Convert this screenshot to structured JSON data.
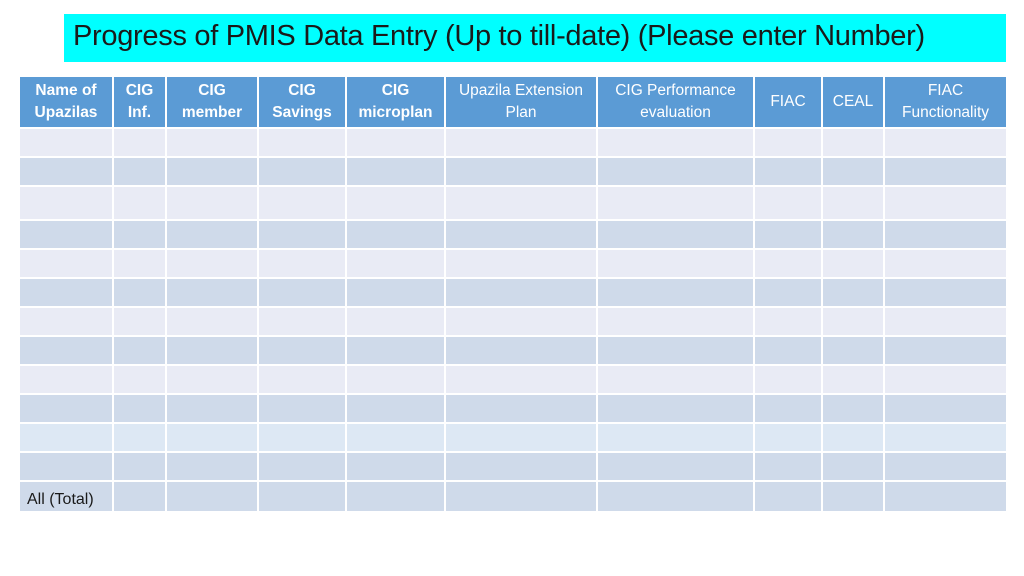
{
  "title": "Progress of PMIS Data Entry (Up to till-date) (Please enter Number)",
  "colors": {
    "title_background": "#00FFFF",
    "header_background": "#5B9BD5",
    "row_light": "#E9EBF5",
    "row_dark": "#CFDAEA"
  },
  "table": {
    "columns": [
      {
        "line1": "Name of",
        "line2": "Upazilas"
      },
      {
        "line1": "CIG",
        "line2": "Inf."
      },
      {
        "line1": "CIG",
        "line2": "member"
      },
      {
        "line1": "CIG",
        "line2": "Savings"
      },
      {
        "line1": "CIG",
        "line2": "microplan"
      },
      {
        "line1": "Upazila Extension",
        "line2": "Plan"
      },
      {
        "line1": "CIG Performance",
        "line2": "evaluation"
      },
      {
        "line1": "FIAC",
        "line2": ""
      },
      {
        "line1": "CEAL",
        "line2": ""
      },
      {
        "line1": "FIAC",
        "line2": "Functionality"
      }
    ],
    "rows": [
      [
        "",
        "",
        "",
        "",
        "",
        "",
        "",
        "",
        "",
        ""
      ],
      [
        "",
        "",
        "",
        "",
        "",
        "",
        "",
        "",
        "",
        ""
      ],
      [
        "",
        "",
        "",
        "",
        "",
        "",
        "",
        "",
        "",
        ""
      ],
      [
        "",
        "",
        "",
        "",
        "",
        "",
        "",
        "",
        "",
        ""
      ],
      [
        "",
        "",
        "",
        "",
        "",
        "",
        "",
        "",
        "",
        ""
      ],
      [
        "",
        "",
        "",
        "",
        "",
        "",
        "",
        "",
        "",
        ""
      ],
      [
        "",
        "",
        "",
        "",
        "",
        "",
        "",
        "",
        "",
        ""
      ],
      [
        "",
        "",
        "",
        "",
        "",
        "",
        "",
        "",
        "",
        ""
      ],
      [
        "",
        "",
        "",
        "",
        "",
        "",
        "",
        "",
        "",
        ""
      ],
      [
        "",
        "",
        "",
        "",
        "",
        "",
        "",
        "",
        "",
        ""
      ],
      [
        "",
        "",
        "",
        "",
        "",
        "",
        "",
        "",
        "",
        ""
      ],
      [
        "",
        "",
        "",
        "",
        "",
        "",
        "",
        "",
        "",
        ""
      ]
    ],
    "total_row_label": "All (Total)"
  }
}
